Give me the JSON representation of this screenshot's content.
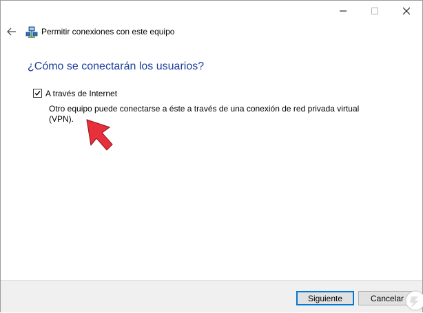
{
  "window": {
    "title": "Permitir conexiones con este equipo",
    "controls": {
      "minimize": "minimize-icon",
      "maximize": "maximize-icon",
      "close": "close-icon"
    }
  },
  "header": {
    "back_icon": "back-arrow-icon",
    "app_icon": "network-connections-icon"
  },
  "main": {
    "question": "¿Cómo se conectarán los usuarios?",
    "option": {
      "label": "A través de Internet",
      "checked": true,
      "description": "Otro equipo puede conectarse a éste a través de una conexión de red privada virtual (VPN)."
    },
    "annotation_icon": "red-pointer-arrow-icon"
  },
  "footer": {
    "next_label": "Siguiente",
    "cancel_label": "Cancelar"
  },
  "colors": {
    "question_text": "#1a3d9e",
    "accent": "#0078d7",
    "pointer": "#e8303c"
  }
}
